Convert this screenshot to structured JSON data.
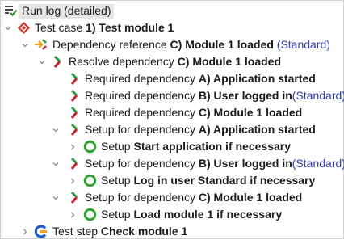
{
  "root": {
    "label": "Run log (detailed)"
  },
  "rows": [
    {
      "prefix": "Test case",
      "name": "1) Test module 1",
      "tag": ""
    },
    {
      "prefix": "Dependency reference",
      "name": "C) Module 1 loaded",
      "tag": "(Standard)"
    },
    {
      "prefix": "Resolve dependency",
      "name": "C) Module 1 loaded",
      "tag": ""
    },
    {
      "prefix": "Required dependency",
      "name": "A) Application started",
      "tag": ""
    },
    {
      "prefix": "Required dependency",
      "name": "B) User logged in",
      "tag": "(Standard)"
    },
    {
      "prefix": "Required dependency",
      "name": "C) Module 1 loaded",
      "tag": ""
    },
    {
      "prefix": "Setup for dependency",
      "name": "A) Application started",
      "tag": ""
    },
    {
      "prefix": "Setup",
      "name": "Start application if necessary",
      "tag": ""
    },
    {
      "prefix": "Setup for dependency",
      "name": "B) User logged in",
      "tag": "(Standard)"
    },
    {
      "prefix": "Setup",
      "name": "Log in user Standard if necessary",
      "tag": ""
    },
    {
      "prefix": "Setup for dependency",
      "name": "C) Module 1 loaded",
      "tag": ""
    },
    {
      "prefix": "Setup",
      "name": "Load module 1 if necessary",
      "tag": ""
    },
    {
      "prefix": "Test step",
      "name": "Check module 1",
      "tag": ""
    }
  ],
  "colors": {
    "accent_blue": "#2e3fb0",
    "dependency_red": "#c0242b",
    "dependency_green": "#2f9a3a",
    "dependency_yellow": "#e8a51c",
    "setup_green": "#2fa52f",
    "testcase_red": "#d8321f",
    "teststep_blue": "#1f5fd0",
    "teststep_orange": "#f2a320"
  },
  "icons": {
    "root": "run-log-icon",
    "test_case": "test-case-icon",
    "dependency_reference": "dependency-reference-icon",
    "dependency": "dependency-icon",
    "setup": "setup-ring-icon",
    "test_step": "test-step-icon"
  }
}
